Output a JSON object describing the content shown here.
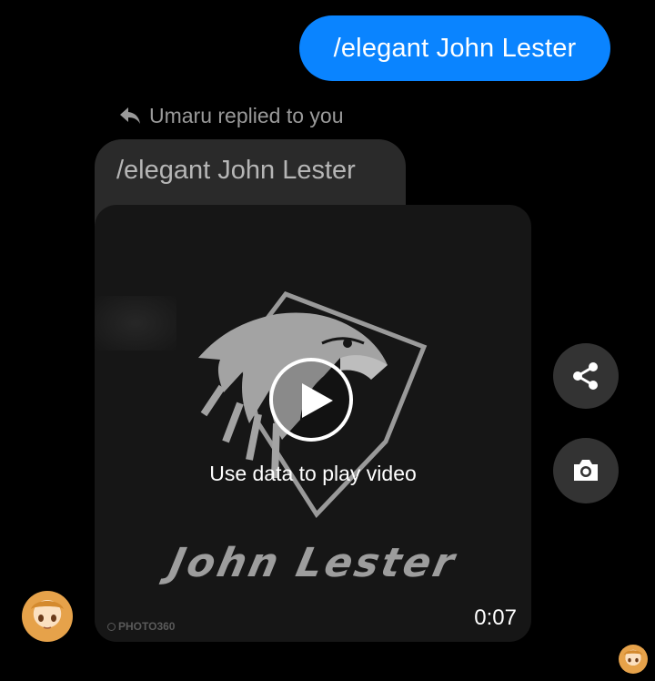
{
  "sent_message": {
    "text": "/elegant John Lester"
  },
  "reply_indicator": {
    "text": "Umaru replied to you",
    "icon": "reply-arrow-icon"
  },
  "quoted_message": {
    "text": "/elegant John Lester"
  },
  "video": {
    "brand_text": "John Lester",
    "caption": "Use data to play video",
    "duration": "0:07",
    "watermark": "PHOTO360",
    "play_icon": "play-icon"
  },
  "actions": {
    "share_icon": "share-icon",
    "camera_icon": "camera-icon"
  },
  "colors": {
    "sent_bubble": "#0a84ff",
    "received_bubble": "#2a2a2a",
    "background": "#000000"
  }
}
